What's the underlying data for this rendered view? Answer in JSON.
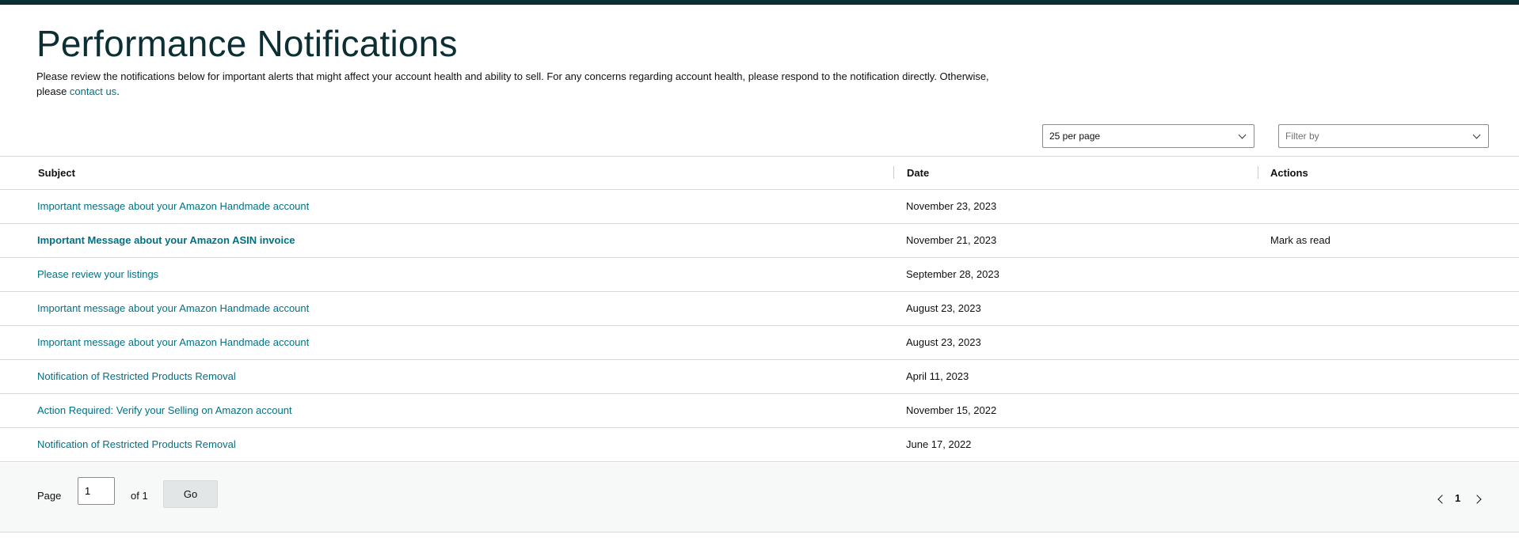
{
  "page": {
    "title": "Performance Notifications",
    "description_prefix": "Please review the notifications below for important alerts that might affect your account health and ability to sell. For any concerns regarding account health, please respond to the notification directly. Otherwise, please ",
    "contact_link": "contact us",
    "description_suffix": "."
  },
  "controls": {
    "per_page_value": "25 per page",
    "filter_placeholder": "Filter by"
  },
  "table": {
    "headers": {
      "subject": "Subject",
      "date": "Date",
      "actions": "Actions"
    },
    "rows": [
      {
        "subject": "Important message about your Amazon Handmade account",
        "date": "November 23, 2023",
        "action": "",
        "unread": false
      },
      {
        "subject": "Important Message about your Amazon ASIN invoice",
        "date": "November 21, 2023",
        "action": "Mark as read",
        "unread": true
      },
      {
        "subject": "Please review your listings",
        "date": "September 28, 2023",
        "action": "",
        "unread": false
      },
      {
        "subject": "Important message about your Amazon Handmade account",
        "date": "August 23, 2023",
        "action": "",
        "unread": false
      },
      {
        "subject": "Important message about your Amazon Handmade account",
        "date": "August 23, 2023",
        "action": "",
        "unread": false
      },
      {
        "subject": "Notification of Restricted Products Removal",
        "date": "April 11, 2023",
        "action": "",
        "unread": false
      },
      {
        "subject": "Action Required: Verify your Selling on Amazon account",
        "date": "November 15, 2022",
        "action": "",
        "unread": false
      },
      {
        "subject": "Notification of Restricted Products Removal",
        "date": "June 17, 2022",
        "action": "",
        "unread": false
      }
    ]
  },
  "pagination": {
    "page_label": "Page",
    "page_value": "1",
    "of_label": "of 1",
    "go_label": "Go",
    "current_page": "1",
    "prev_icon": "chevron-left-icon",
    "next_icon": "chevron-right-icon"
  },
  "colors": {
    "brand_dark": "#0b2f33",
    "link": "#007185",
    "border": "#d5d9d9",
    "footer_bg": "#f7f8f8"
  }
}
